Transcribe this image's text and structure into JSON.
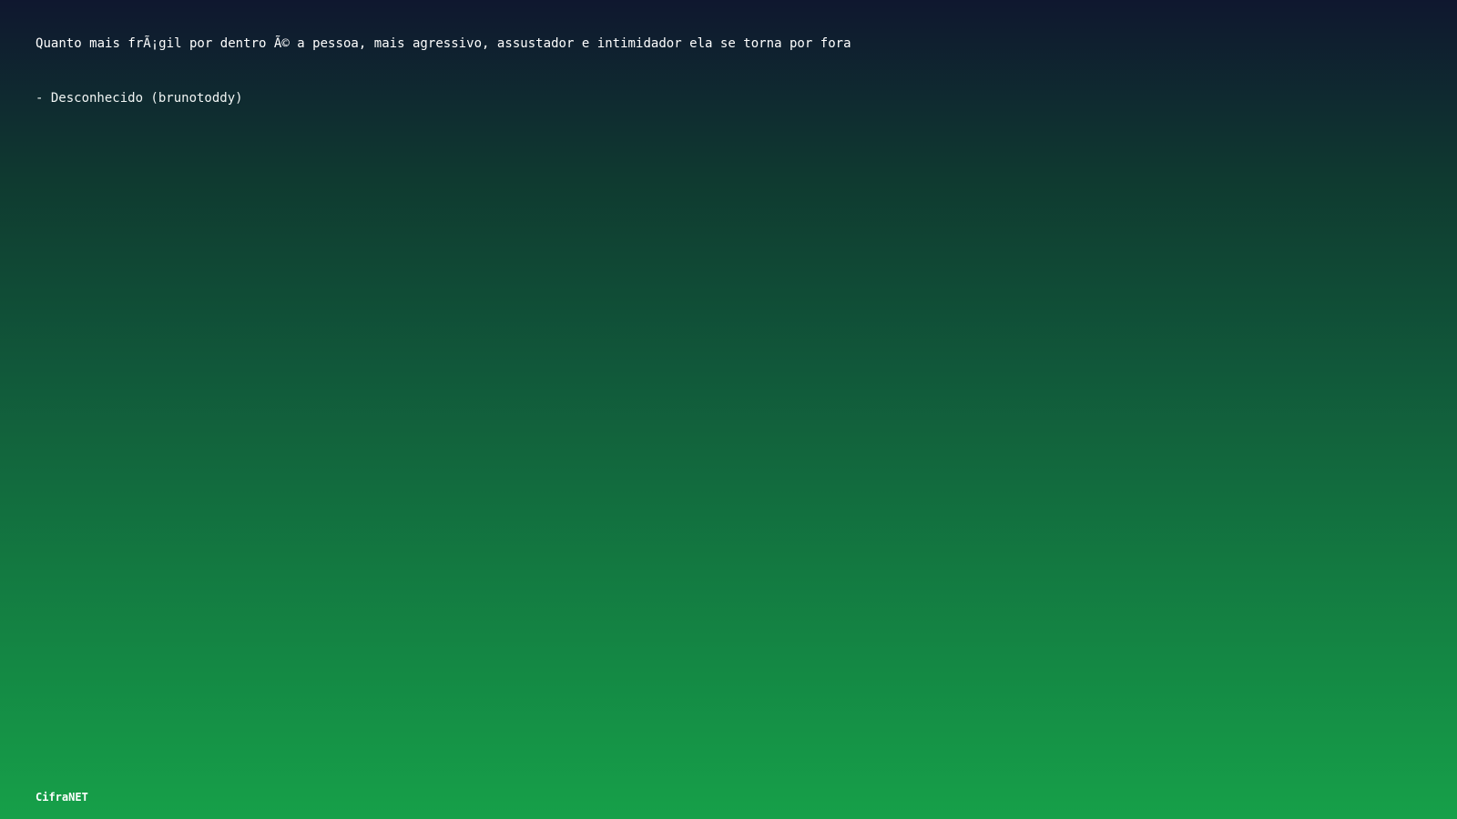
{
  "quote": {
    "text": "Quanto mais frÃ¡gil por dentro Ã© a pessoa, mais agressivo, assustador e intimidador ela se torna por fora",
    "author": "- Desconhecido (brunotoddy)"
  },
  "footer": {
    "brand": "CifraNET"
  },
  "colors": {
    "gradient_top": "#0f172f",
    "gradient_bottom": "#16a049",
    "text": "#ffffff"
  }
}
